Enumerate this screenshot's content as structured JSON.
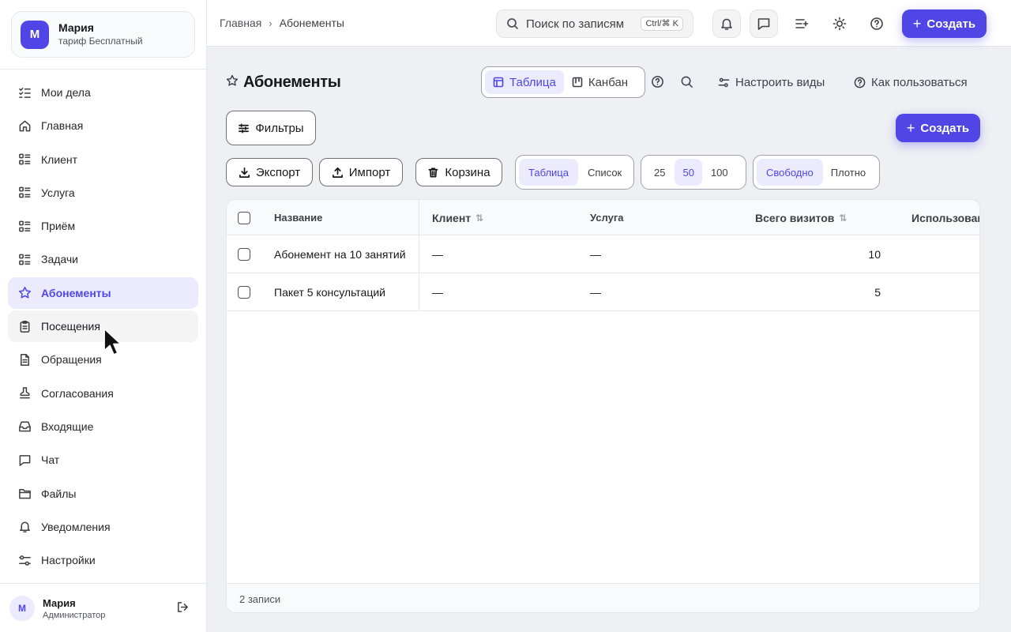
{
  "workspace": {
    "avatar": "М",
    "name": "Мария",
    "plan": "тариф Бесплатный"
  },
  "sidebar": {
    "items": [
      {
        "label": "Мои дела",
        "icon": "list-check-icon"
      },
      {
        "label": "Главная",
        "icon": "home-icon"
      },
      {
        "label": "Клиент",
        "icon": "list-icon"
      },
      {
        "label": "Услуга",
        "icon": "list-icon"
      },
      {
        "label": "Приём",
        "icon": "list-icon"
      },
      {
        "label": "Задачи",
        "icon": "list-icon"
      },
      {
        "label": "Абонементы",
        "icon": "star-icon",
        "active": true
      },
      {
        "label": "Посещения",
        "icon": "clipboard-icon",
        "hover": true
      },
      {
        "label": "Обращения",
        "icon": "document-icon"
      },
      {
        "label": "Согласования",
        "icon": "stamp-icon"
      },
      {
        "label": "Входящие",
        "icon": "inbox-icon"
      },
      {
        "label": "Чат",
        "icon": "chat-icon"
      },
      {
        "label": "Файлы",
        "icon": "folder-icon"
      },
      {
        "label": "Уведомления",
        "icon": "bell-icon"
      },
      {
        "label": "Настройки",
        "icon": "settings-sliders-icon"
      }
    ]
  },
  "user": {
    "avatar": "М",
    "name": "Мария",
    "role": "Администратор"
  },
  "topbar": {
    "breadcrumbs": [
      "Главная",
      "Абонементы"
    ],
    "breadcrumb_sep": "›",
    "search_placeholder": "Поиск по записям",
    "search_shortcut": "Ctrl/⌘ K",
    "create_label": "Создать"
  },
  "page": {
    "title": "Абонементы",
    "views": [
      {
        "label": "Таблица",
        "icon": "table-icon",
        "active": true
      },
      {
        "label": "Канбан",
        "icon": "kanban-icon",
        "active": false
      }
    ],
    "configure_views": "Настроить виды",
    "how_to_use": "Как пользоваться",
    "filters_label": "Фильтры",
    "create_label": "Создать",
    "export_label": "Экспорт",
    "import_label": "Импорт",
    "trash_label": "Корзина",
    "display_modes": [
      {
        "label": "Таблица",
        "active": true
      },
      {
        "label": "Список",
        "active": false
      }
    ],
    "page_sizes": [
      {
        "label": "25",
        "active": false
      },
      {
        "label": "50",
        "active": true
      },
      {
        "label": "100",
        "active": false
      }
    ],
    "densities": [
      {
        "label": "Свободно",
        "active": true
      },
      {
        "label": "Плотно",
        "active": false
      }
    ]
  },
  "table": {
    "columns": [
      {
        "label": "Название",
        "sortable": false
      },
      {
        "label": "Клиент",
        "sortable": true
      },
      {
        "label": "Услуга",
        "sortable": false
      },
      {
        "label": "Всего визитов",
        "sortable": true
      },
      {
        "label": "Использовано",
        "sortable": false
      }
    ],
    "rows": [
      {
        "name": "Абонемент на 10 занятий",
        "client": "—",
        "service": "—",
        "visits": "10"
      },
      {
        "name": "Пакет 5 консультаций",
        "client": "—",
        "service": "—",
        "visits": "5"
      }
    ],
    "footer": "2 записи"
  }
}
